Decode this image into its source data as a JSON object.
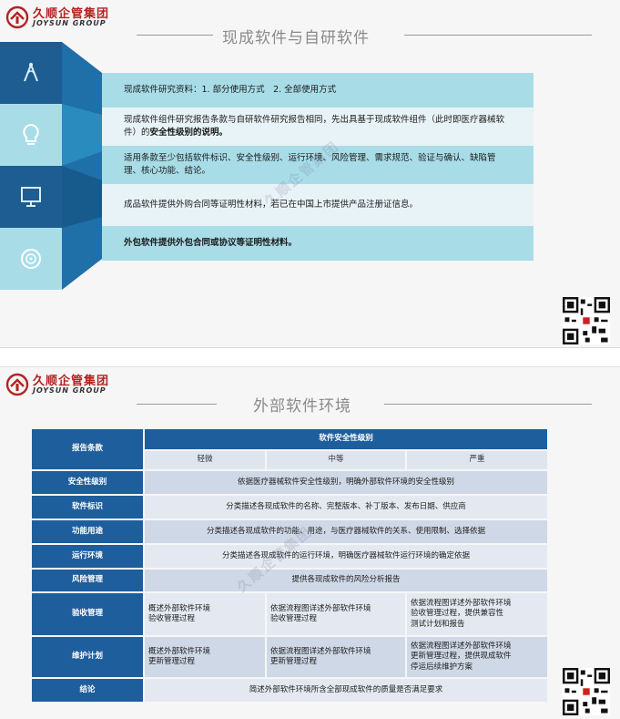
{
  "logo": {
    "cn": "久顺企管集团",
    "en": "JOYSUN GROUP"
  },
  "slide1": {
    "title": "现成软件与自研软件",
    "icons": [
      "antenna-icon",
      "lightbulb-icon",
      "monitor-icon",
      "disc-icon"
    ],
    "rows": [
      {
        "text": "现成软件研究资料：1. 部分使用方式　2. 全部使用方式",
        "strong": ""
      },
      {
        "text": "现成软件组件研究报告条款与自研软件研究报告相同，先出具基于现成软件组件（此时即医疗器械软件）的",
        "strong": "安全性级别的说明。"
      },
      {
        "text": "适用条款至少包括软件标识、安全性级别、运行环境、风险管理、需求规范、验证与确认、缺陷管理、核心功能、结论。",
        "strong": ""
      },
      {
        "text": "成品软件提供外购合同等证明性材料，若已在中国上市提供产品注册证信息。",
        "strong": ""
      },
      {
        "text": "",
        "strong": "外包软件提供外包合同或协议等证明性材料。"
      }
    ],
    "watermark": "久顺企管集团"
  },
  "slide2": {
    "title": "外部软件环境",
    "watermark": "久顺企管集团",
    "table": {
      "corner": "报告条款",
      "group_header": "软件安全性级别",
      "levels": [
        "轻微",
        "中等",
        "严重"
      ],
      "rows": [
        {
          "label": "安全性级别",
          "merged": "依据医疗器械软件安全性级别，明确外部软件环境的安全性级别"
        },
        {
          "label": "软件标识",
          "merged": "分类描述各现成软件的名称、完整版本、补丁版本、发布日期、供应商"
        },
        {
          "label": "功能用途",
          "merged": "分类描述各现成软件的功能、用途，与医疗器械软件的关系、使用限制、选择依据"
        },
        {
          "label": "运行环境",
          "merged": "分类描述各现成软件的运行环境，明确医疗器械软件运行环境的确定依据"
        },
        {
          "label": "风险管理",
          "merged": "提供各现成软件的风险分析报告"
        },
        {
          "label": "验收管理",
          "cells": [
            "概述外部软件环境\n验收管理过程",
            "依据流程图详述外部软件环境\n验收管理过程",
            "依据流程图详述外部软件环境\n验收管理过程，提供兼容性\n测试计划和报告"
          ]
        },
        {
          "label": "维护计划",
          "cells": [
            "概述外部软件环境\n更新管理过程",
            "依据流程图详述外部软件环境\n更新管理过程",
            "依据流程图详述外部软件环境\n更新管理过程，提供现成软件\n停运后续维护方案"
          ]
        },
        {
          "label": "结论",
          "merged": "简述外部软件环境所含全部现成软件的质量是否满足要求"
        }
      ]
    }
  },
  "colors": {
    "brand_red": "#b52222",
    "band_dark": "#1f5e9c",
    "band_light": "#a8dde8",
    "table_header": "#1f5e9c"
  }
}
